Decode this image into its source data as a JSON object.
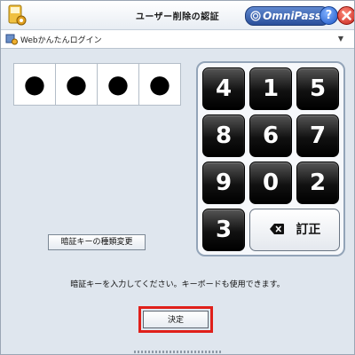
{
  "window": {
    "title": "ユーザー削除の認証",
    "brand": "OmniPass",
    "help_label": "?"
  },
  "subbar": {
    "label": "Webかんたんログイン",
    "arrow": "▼"
  },
  "pin": {
    "boxes": [
      "●",
      "●",
      "●",
      "●"
    ]
  },
  "keypad": {
    "keys": [
      "4",
      "1",
      "5",
      "8",
      "6",
      "7",
      "9",
      "0",
      "2",
      "3"
    ],
    "back_label": "訂正"
  },
  "buttons": {
    "change_key_type": "暗証キーの種類変更",
    "ok": "決定"
  },
  "hint": "暗証キーを入力してください。キーボードも使用できます。",
  "colors": {
    "window_bg": "#dfe6ee",
    "highlight": "#e0201a",
    "key_bg": "#000000",
    "brand": "#2a4f9a"
  }
}
